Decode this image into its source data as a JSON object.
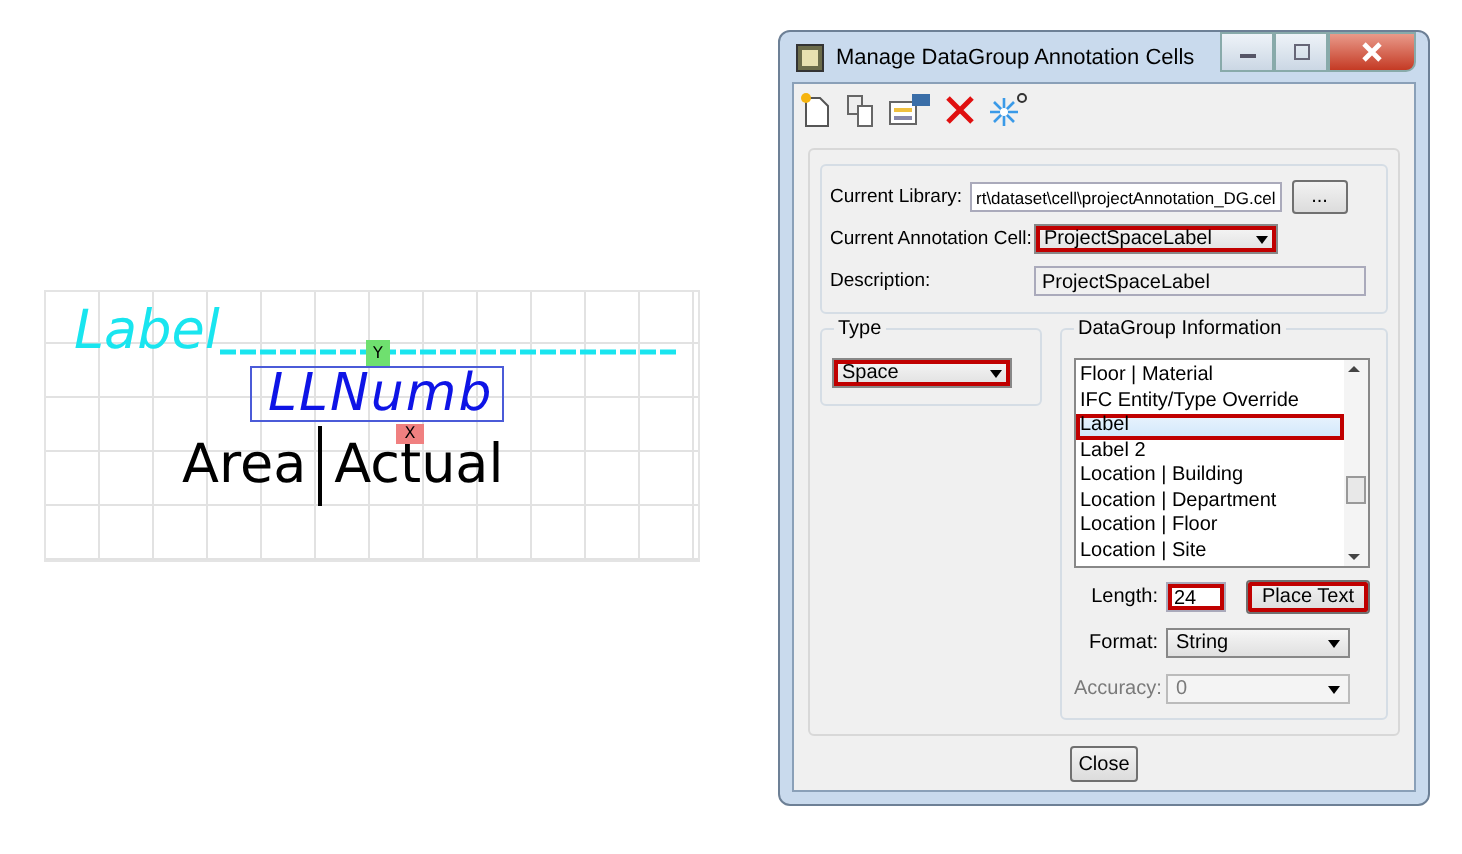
{
  "drawing": {
    "label_text": "Label",
    "selected_text": "LLNumb",
    "axis_y": "Y",
    "axis_x": "X",
    "area_text": "Area",
    "actual_text": "Actual"
  },
  "window": {
    "title": "Manage DataGroup Annotation Cells"
  },
  "toolbar": [
    {
      "kind": "new"
    },
    {
      "kind": "copy"
    },
    {
      "kind": "edit"
    },
    {
      "kind": "delete"
    },
    {
      "kind": "spark"
    }
  ],
  "library": {
    "label": "Current Library:",
    "value": "rt\\dataset\\cell\\projectAnnotation_DG.cel",
    "browse": "..."
  },
  "annotation_cell": {
    "label": "Current Annotation Cell:",
    "value": "ProjectSpaceLabel",
    "highlighted": true
  },
  "description": {
    "label": "Description:",
    "value": "ProjectSpaceLabel"
  },
  "type_group": {
    "title": "Type",
    "value": "Space",
    "highlighted": true
  },
  "datagroup": {
    "title": "DataGroup Information",
    "items": [
      {
        "text": "Floor | Material",
        "selected": false,
        "highlighted": false
      },
      {
        "text": "IFC Entity/Type Override",
        "selected": false,
        "highlighted": false
      },
      {
        "text": "Label",
        "selected": true,
        "highlighted": true
      },
      {
        "text": "Label 2",
        "selected": false,
        "highlighted": false
      },
      {
        "text": "Location | Building",
        "selected": false,
        "highlighted": false
      },
      {
        "text": "Location | Department",
        "selected": false,
        "highlighted": false
      },
      {
        "text": "Location | Floor",
        "selected": false,
        "highlighted": false
      },
      {
        "text": "Location | Site",
        "selected": false,
        "highlighted": false
      }
    ],
    "length": {
      "label": "Length:",
      "value": "24",
      "highlighted": true
    },
    "place_text": {
      "label": "Place Text",
      "highlighted": true
    },
    "format": {
      "label": "Format:",
      "value": "String",
      "disabled": false
    },
    "accuracy": {
      "label": "Accuracy:",
      "value": "0",
      "disabled": true
    }
  },
  "close_button": "Close"
}
